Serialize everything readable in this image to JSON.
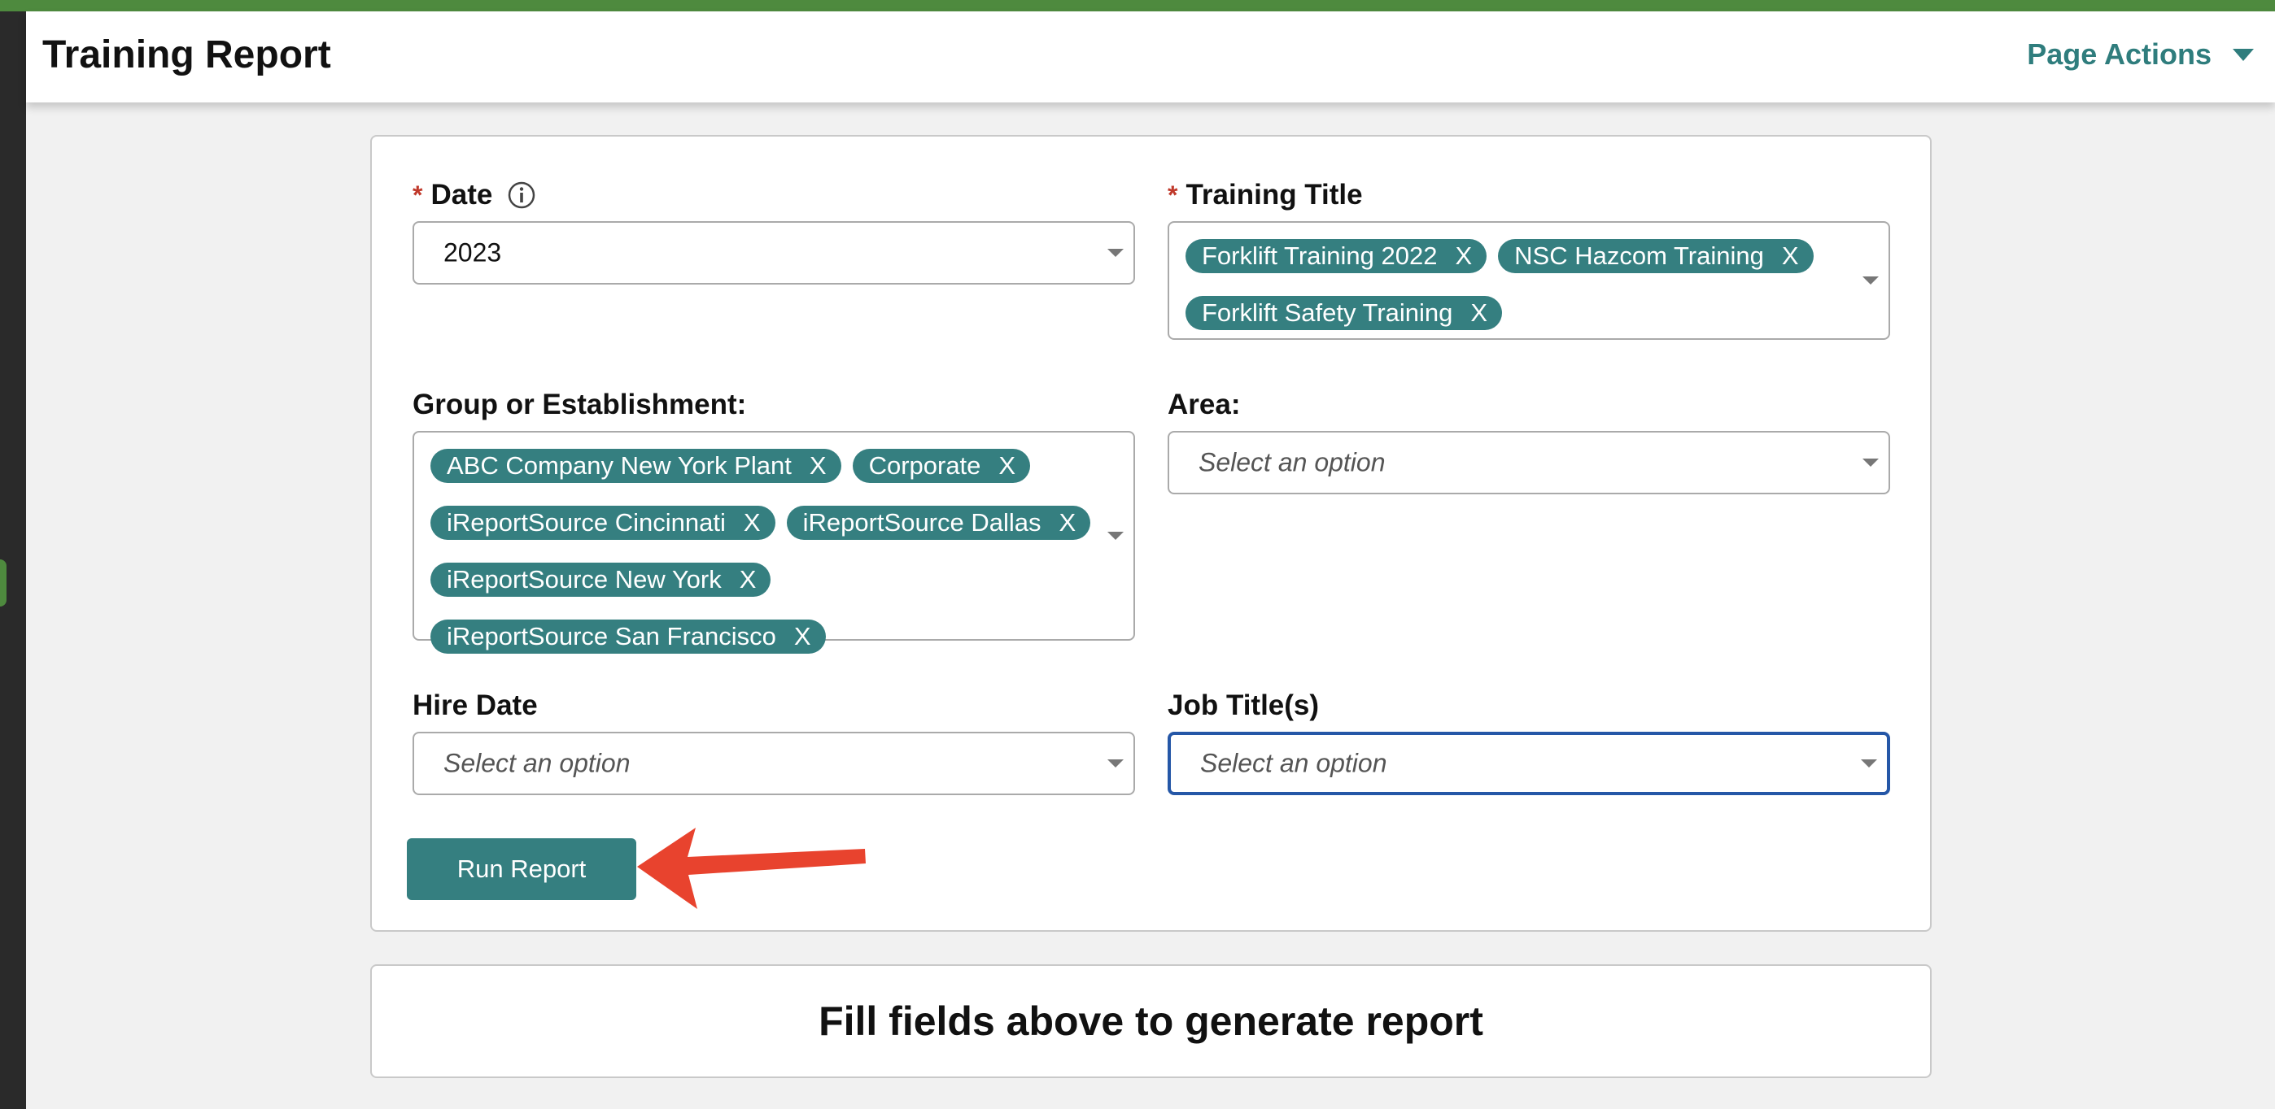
{
  "header": {
    "title": "Training Report",
    "page_actions_label": "Page Actions"
  },
  "form": {
    "date": {
      "label": "Date",
      "required_mark": "*",
      "value": "2023"
    },
    "training_title": {
      "label": "Training Title",
      "required_mark": "*",
      "tags": [
        "Forklift Training 2022",
        "NSC Hazcom Training",
        "Forklift Safety Training"
      ],
      "remove_glyph": "X"
    },
    "group": {
      "label": "Group or Establishment:",
      "tags": [
        "ABC Company New York Plant",
        "Corporate",
        "iReportSource Cincinnati",
        "iReportSource Dallas",
        "iReportSource New York",
        "iReportSource San Francisco"
      ],
      "remove_glyph": "X"
    },
    "area": {
      "label": "Area:",
      "placeholder": "Select an option"
    },
    "hire_date": {
      "label": "Hire Date",
      "placeholder": "Select an option"
    },
    "job_titles": {
      "label": "Job Title(s)",
      "placeholder": "Select an option"
    },
    "run_button_label": "Run Report"
  },
  "report_area": {
    "message": "Fill fields above to generate report"
  },
  "colors": {
    "accent": "#357f80",
    "brand_green": "#4e8a3e",
    "required": "#c0392b",
    "annotation_arrow": "#e8432e",
    "focus_border": "#2557a7"
  },
  "icons": [
    "info-icon",
    "chevron-down-icon",
    "annotation-arrow-icon"
  ]
}
